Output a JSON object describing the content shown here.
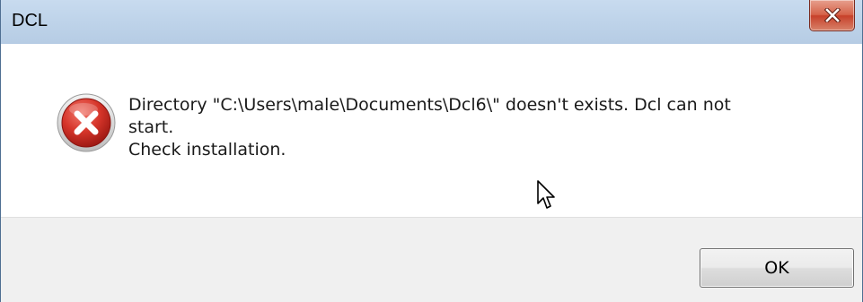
{
  "window": {
    "title": "DCL"
  },
  "dialog": {
    "message_lines": [
      "Directory \"C:\\Users\\male\\Documents\\Dcl6\\\" doesn't exists. Dcl can not",
      "start.",
      "Check installation."
    ],
    "icon": "error-icon"
  },
  "buttons": {
    "ok_label": "OK",
    "close_icon": "close-icon"
  },
  "colors": {
    "title_bar": "#bfd4ea",
    "close_button": "#c7402a",
    "error_icon": "#c62828",
    "footer": "#f0f0f0"
  }
}
